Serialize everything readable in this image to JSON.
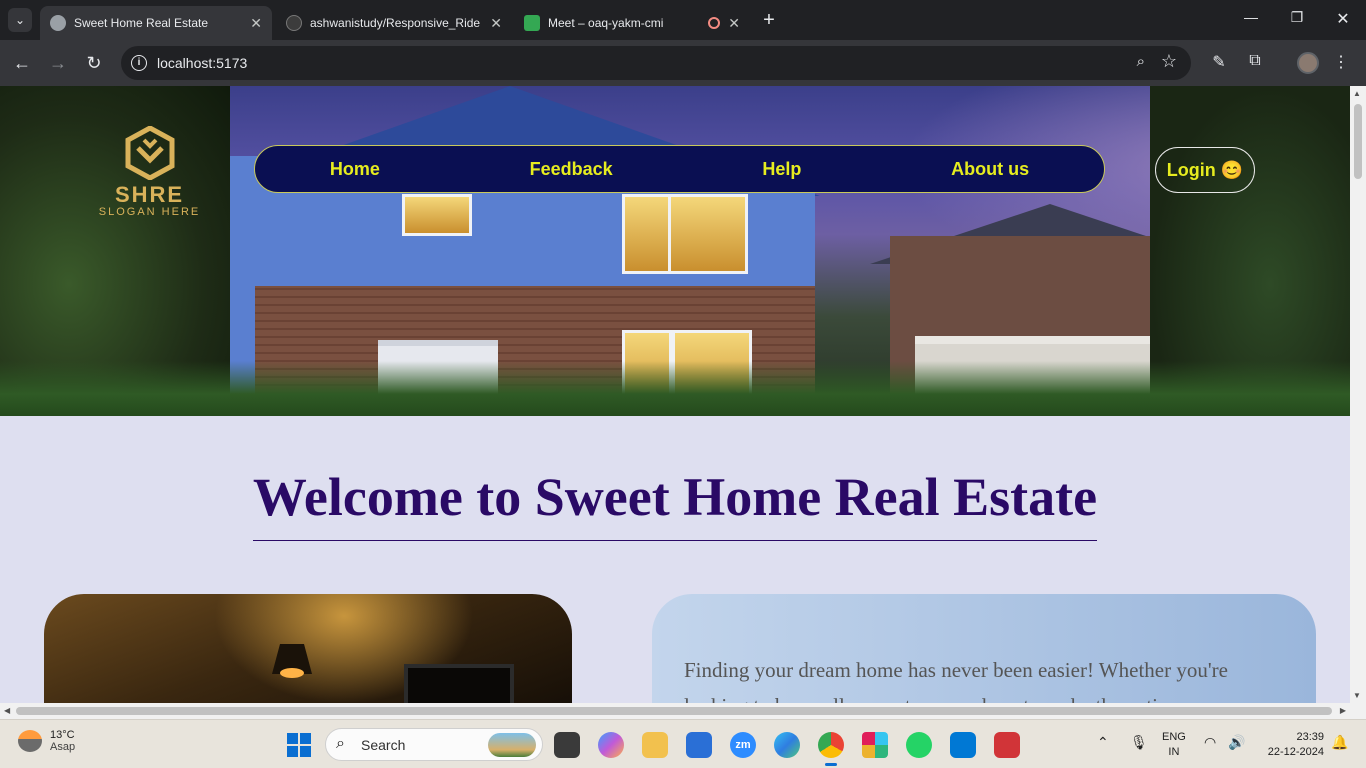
{
  "browser": {
    "tabs": [
      {
        "title": "Sweet Home Real Estate",
        "active": true,
        "favicon_color": "#9aa0a6"
      },
      {
        "title": "ashwanistudy/Responsive_Ride",
        "active": false,
        "favicon_color": "#3c3c3c"
      },
      {
        "title": "Meet – oaq-yakm-cmi",
        "active": false,
        "favicon_color": "#34a853"
      }
    ],
    "url": "localhost:5173"
  },
  "page": {
    "logo": {
      "brand": "SHRE",
      "slogan": "SLOGAN HERE"
    },
    "nav": [
      "Home",
      "Feedback",
      "Help",
      "About us"
    ],
    "login_label": "Login 😊",
    "heading": "Welcome to Sweet Home Real Estate",
    "intro": "Finding your dream home has never been easier! Whether you're looking to buy, sell, or rent, we are here to make the entire process"
  },
  "taskbar": {
    "weather_temp": "13°C",
    "weather_cond": "Asap",
    "search_label": "Search",
    "lang_top": "ENG",
    "lang_bottom": "IN",
    "time": "23:39",
    "date": "22-12-2024"
  },
  "colors": {
    "nav_bg": "#0a0f52",
    "nav_text": "#e6ec1f",
    "heading": "#2a0a66",
    "page_bg": "#dedff0"
  }
}
